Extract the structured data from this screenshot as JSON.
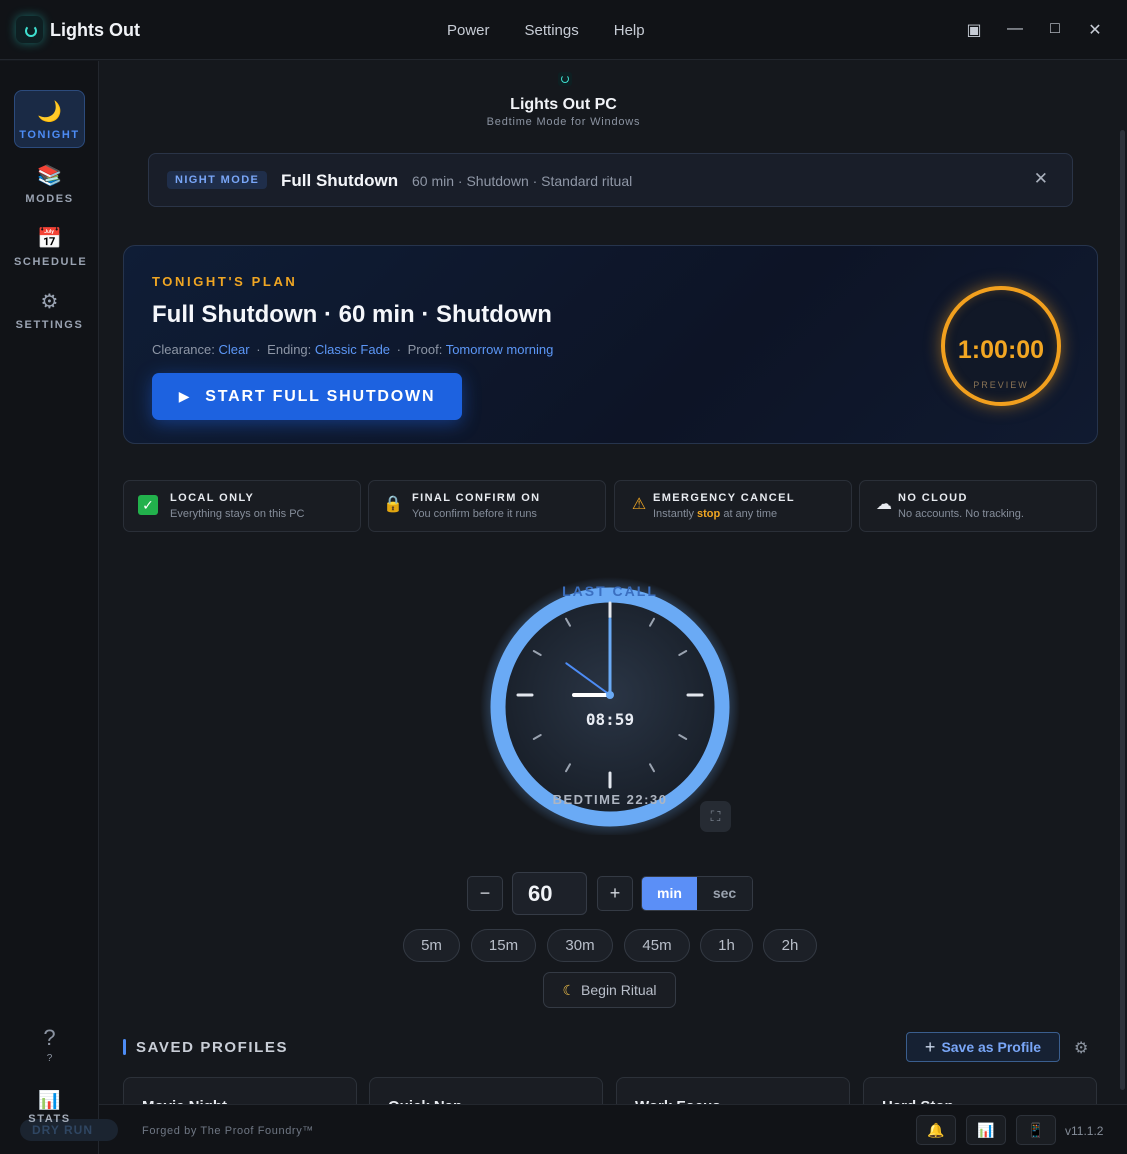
{
  "window": {
    "title": "Lights Out",
    "menu": [
      "Power",
      "Settings",
      "Help"
    ],
    "controls": {
      "pin": "▣",
      "minimize": "—",
      "maximize": "□",
      "close": "✕"
    }
  },
  "sidebar": {
    "items": [
      {
        "label": "TONIGHT",
        "icon": "🌙",
        "active": true
      },
      {
        "label": "MODES",
        "icon": "📚"
      },
      {
        "label": "SCHEDULE",
        "icon": "📅"
      },
      {
        "label": "SETTINGS",
        "icon": "⚙"
      }
    ],
    "help": {
      "icon": "?",
      "label": "?"
    },
    "stats": {
      "icon": "📊",
      "label": "STATS"
    },
    "dry_run": "DRY RUN"
  },
  "brand": {
    "name": "Lights Out PC",
    "subtitle": "Bedtime Mode for Windows"
  },
  "night_mode": {
    "badge": "NIGHT MODE",
    "title": "Full Shutdown",
    "description": "60 min · Shutdown · Standard ritual",
    "close": "✕"
  },
  "plan": {
    "kicker": "TONIGHT'S PLAN",
    "title": "Full Shutdown · 60 min · Shutdown",
    "clearance_label": "Clearance:",
    "clearance_value": "Clear",
    "ending_label": "Ending:",
    "ending_value": "Classic Fade",
    "proof_label": "Proof:",
    "proof_value": "Tomorrow morning",
    "start_button": "START FULL SHUTDOWN",
    "preview_time": "1:00:00",
    "preview_label": "PREVIEW"
  },
  "features": [
    {
      "title": "LOCAL ONLY",
      "subtitle": "Everything stays on this PC",
      "icon": "✓"
    },
    {
      "title": "FINAL CONFIRM ON",
      "subtitle": "You confirm before it runs",
      "icon": "🔒"
    },
    {
      "title": "EMERGENCY CANCEL",
      "subtitle_pre": "Instantly ",
      "subtitle_hl": "stop",
      "subtitle_post": " at any time",
      "icon": "⚠"
    },
    {
      "title": "NO CLOUD",
      "subtitle": "No accounts. No tracking.",
      "icon": "☁"
    }
  ],
  "clock": {
    "top_label": "LAST CALL",
    "time": "08:59",
    "bedtime": "BEDTIME 22:30",
    "fullscreen_icon": "⛶",
    "hands": {
      "hour": 9,
      "minute": 0,
      "second": 51
    },
    "ring_color": "#6aaaf5"
  },
  "duration": {
    "minus": "−",
    "plus": "+",
    "value": "60",
    "units": [
      "min",
      "sec"
    ],
    "selected_unit": "min",
    "presets": [
      "5m",
      "15m",
      "30m",
      "45m",
      "1h",
      "2h"
    ],
    "begin_ritual": "Begin Ritual"
  },
  "profiles": {
    "title": "SAVED PROFILES",
    "save_button": "Save as Profile",
    "cards": [
      "Movie Night",
      "Quick Nap",
      "Work Focus",
      "Hard Stop"
    ]
  },
  "status": {
    "forged": "Forged by The Proof Foundry™",
    "buttons": [
      "🔔",
      "📊",
      "📱"
    ],
    "version": "v11.1.2"
  },
  "colors": {
    "accent": "#1d62e0",
    "amber": "#f2a01e",
    "link": "#5c97f7"
  }
}
